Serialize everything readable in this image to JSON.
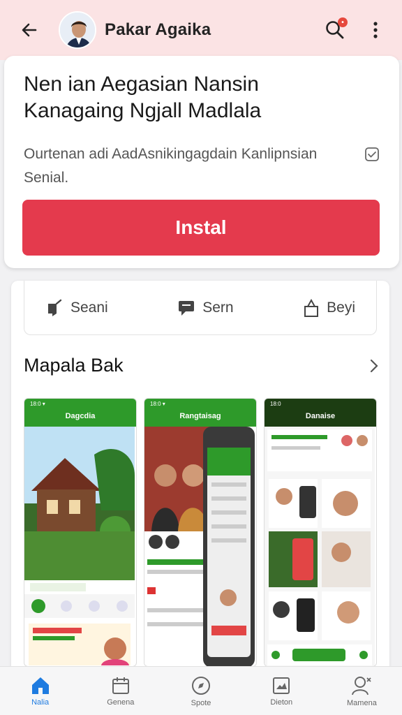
{
  "header": {
    "title": "Pakar Agaika",
    "notification_count": "•"
  },
  "app": {
    "title_line1": "Nen ian Aegasian Nansin",
    "title_line2": "Kanagaing Ngjall Madlala",
    "description": "Ourtenan adi AadAsnikingagdain Kanlipnsian Senial.",
    "install_label": "Instal"
  },
  "actions": [
    {
      "label": "Seani",
      "icon": "share-icon"
    },
    {
      "label": "Sern",
      "icon": "chat-icon"
    },
    {
      "label": "Beyi",
      "icon": "bag-icon"
    }
  ],
  "section": {
    "title": "Mapala Bak"
  },
  "screenshots": [
    {
      "status": "18:0 ▾",
      "title": "Dagcdia"
    },
    {
      "status": "18:0 ▾",
      "title": "Rangtaisag"
    },
    {
      "status": "18:0",
      "title": "Danaise"
    }
  ],
  "colors": {
    "accent": "#e43a4d",
    "header_bg": "#fbe3e4",
    "green": "#2e9a2a",
    "nav_active": "#1e7be0"
  },
  "bottom_nav": [
    {
      "label": "Nalia",
      "icon": "home-icon",
      "active": true
    },
    {
      "label": "Genena",
      "icon": "calendar-icon",
      "active": false
    },
    {
      "label": "Spote",
      "icon": "compass-icon",
      "active": false
    },
    {
      "label": "Dieton",
      "icon": "picture-frame-icon",
      "active": false
    },
    {
      "label": "Mamena",
      "icon": "profile-icon",
      "active": false
    }
  ]
}
